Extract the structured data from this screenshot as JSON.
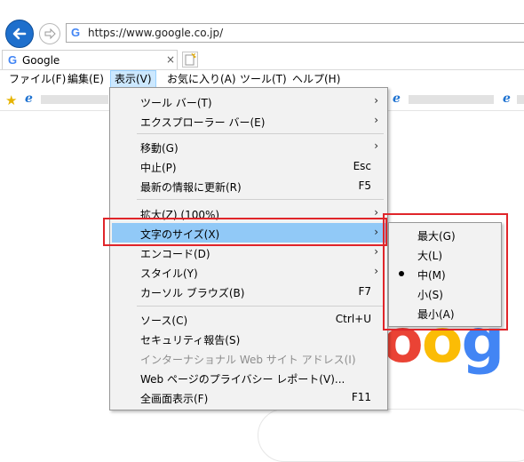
{
  "addressbar": {
    "url": "https://www.google.co.jp/",
    "favicon_letter": "G"
  },
  "tab": {
    "favicon_letter": "G",
    "title": "Google",
    "close": "×"
  },
  "menubar": {
    "items": [
      {
        "label": "ファイル(F)"
      },
      {
        "label": "編集(E)"
      },
      {
        "label": "表示(V)",
        "active": true
      },
      {
        "label": "お気に入り(A)"
      },
      {
        "label": "ツール(T)"
      },
      {
        "label": "ヘルプ(H)"
      }
    ]
  },
  "view_menu": {
    "items": [
      {
        "label": "ツール バー(T)",
        "shortcut": "",
        "submenu": true
      },
      {
        "label": "エクスプローラー バー(E)",
        "shortcut": "",
        "submenu": true
      },
      {
        "label": "移動(G)",
        "shortcut": "",
        "submenu": true
      },
      {
        "label": "中止(P)",
        "shortcut": "Esc"
      },
      {
        "label": "最新の情報に更新(R)",
        "shortcut": "F5"
      },
      {
        "label": "拡大(Z) (100%)",
        "shortcut": "",
        "submenu": true
      },
      {
        "label": "文字のサイズ(X)",
        "shortcut": "",
        "submenu": true,
        "highlighted": true
      },
      {
        "label": "エンコード(D)",
        "shortcut": "",
        "submenu": true
      },
      {
        "label": "スタイル(Y)",
        "shortcut": "",
        "submenu": true
      },
      {
        "label": "カーソル ブラウズ(B)",
        "shortcut": "F7"
      },
      {
        "label": "ソース(C)",
        "shortcut": "Ctrl+U"
      },
      {
        "label": "セキュリティ報告(S)",
        "shortcut": ""
      },
      {
        "label": "インターナショナル Web サイト アドレス(I)",
        "shortcut": "",
        "disabled": true
      },
      {
        "label": "Web ページのプライバシー レポート(V)...",
        "shortcut": ""
      },
      {
        "label": "全画面表示(F)",
        "shortcut": "F11"
      }
    ],
    "arrow": "›"
  },
  "text_size_menu": {
    "items": [
      {
        "label": "最大(G)"
      },
      {
        "label": "大(L)"
      },
      {
        "label": "中(M)",
        "selected": true
      },
      {
        "label": "小(S)"
      },
      {
        "label": "最小(A)"
      }
    ]
  },
  "background_logo": {
    "text": "oog",
    "colors": [
      "#ea4335",
      "#fbbc05",
      "#4285f4"
    ]
  },
  "colors": {
    "highlight": "#91c9f7",
    "menubar_active": "#cce8ff",
    "annotation_red": "#e0252a"
  }
}
